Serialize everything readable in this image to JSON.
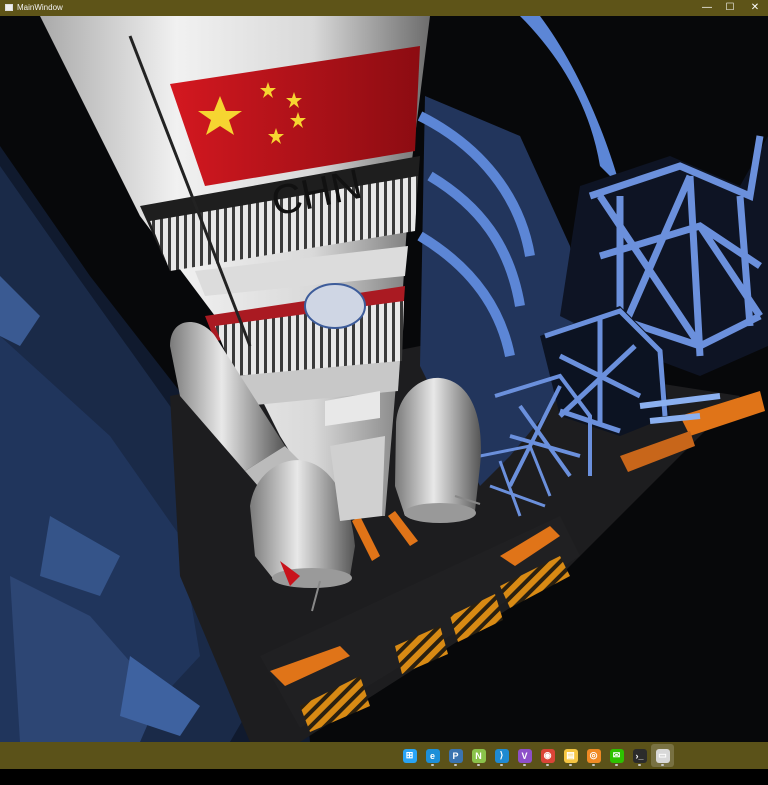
{
  "window": {
    "title": "MainWindow",
    "controls": {
      "minimize": "—",
      "maximize": "☐",
      "close": "✕"
    }
  },
  "scene": {
    "rocket_text": "CHN",
    "colors": {
      "titlebar": "#5e5418",
      "taskbar": "#5b5219",
      "flag_red": "#c8131c",
      "flag_star": "#f6d531",
      "tower_blue": "#5c86d6",
      "pad_orange": "#e07418"
    }
  },
  "taskbar": {
    "icons": [
      {
        "name": "windows-start-icon",
        "color": "#2aa4f4",
        "glyph": "⊞"
      },
      {
        "name": "edge-icon",
        "color": "#1d8fd8",
        "glyph": "e"
      },
      {
        "name": "python-icon",
        "color": "#3b74b0",
        "glyph": "P"
      },
      {
        "name": "notepad-plus-icon",
        "color": "#8bc34a",
        "glyph": "N"
      },
      {
        "name": "vscode-icon",
        "color": "#1f8ad2",
        "glyph": "⟩"
      },
      {
        "name": "visual-studio-icon",
        "color": "#8e4fc9",
        "glyph": "V"
      },
      {
        "name": "chrome-icon",
        "color": "#db4437",
        "glyph": "◉"
      },
      {
        "name": "file-explorer-icon",
        "color": "#f5c542",
        "glyph": "▤"
      },
      {
        "name": "blender-icon",
        "color": "#f08a24",
        "glyph": "◎"
      },
      {
        "name": "wechat-icon",
        "color": "#2dc100",
        "glyph": "✉"
      },
      {
        "name": "terminal-icon",
        "color": "#2b2b2b",
        "glyph": "›_"
      },
      {
        "name": "mainwindow-app-icon",
        "color": "#d8d8d8",
        "glyph": "▭"
      }
    ]
  }
}
